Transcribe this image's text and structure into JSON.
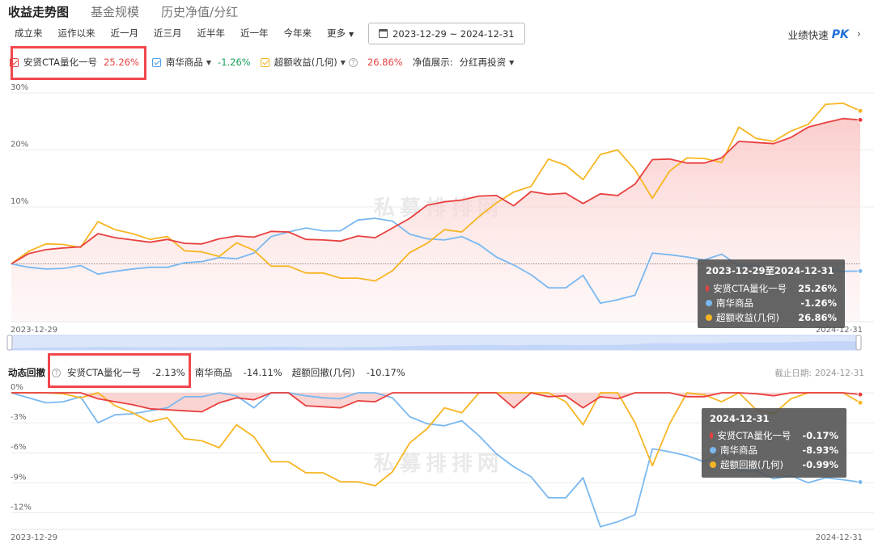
{
  "tabs": [
    "收益走势图",
    "基金规模",
    "历史净值/分红"
  ],
  "ranges": [
    "成立来",
    "运作以来",
    "近一月",
    "近三月",
    "近半年",
    "近一年",
    "今年来"
  ],
  "more_label": "更多",
  "date_range": "2023-12-29 ~ 2024-12-31",
  "pk": {
    "label": "业绩快速",
    "logo": "PK"
  },
  "legend": {
    "fund": {
      "name": "安贤CTA量化一号",
      "value": "25.26%"
    },
    "bench": {
      "name": "南华商品",
      "value": "-1.26%"
    },
    "excess": {
      "name": "超额收益(几何)",
      "value": "26.86%"
    },
    "nav_label": "净值展示:",
    "nav_mode": "分红再投资"
  },
  "watermark": "私募排排网",
  "drawdown_header": {
    "title": "动态回撤",
    "fund": {
      "name": "安贤CTA量化一号",
      "value": "-2.13%"
    },
    "bench": {
      "name": "南华商品",
      "value": "-14.11%"
    },
    "excess": {
      "name": "超额回撤(几何)",
      "value": "-10.17%"
    },
    "deadline_label": "截止日期:",
    "deadline_value": "2024-12-31"
  },
  "tooltip_top": {
    "title": "2023-12-29至2024-12-31",
    "rows": [
      {
        "name": "安贤CTA量化一号",
        "value": "25.26%"
      },
      {
        "name": "南华商品",
        "value": "-1.26%"
      },
      {
        "name": "超额收益(几何)",
        "value": "26.86%"
      }
    ]
  },
  "tooltip_bottom": {
    "title": "2024-12-31",
    "rows": [
      {
        "name": "安贤CTA量化一号",
        "value": "-0.17%"
      },
      {
        "name": "南华商品",
        "value": "-8.93%"
      },
      {
        "name": "超额回撤(几何)",
        "value": "-0.99%"
      }
    ]
  },
  "colors": {
    "fund": "#e8403f",
    "bench": "#7ab8f0",
    "excess": "#f7b522"
  },
  "chart_data": [
    {
      "type": "line",
      "ylim": [
        -10,
        30
      ],
      "ytick_values": [
        30,
        20,
        10
      ],
      "ytick_labels": [
        "30%",
        "20%",
        "10%"
      ],
      "x_labels": [
        "2023-12-29",
        "2024-12-31"
      ],
      "series": [
        {
          "name": "安贤CTA量化一号",
          "values": [
            0,
            1.8,
            2.5,
            2.8,
            3.0,
            5.3,
            4.6,
            4.2,
            3.8,
            4.3,
            3.6,
            3.5,
            4.4,
            4.9,
            4.7,
            5.7,
            5.6,
            4.3,
            4.2,
            4.0,
            4.9,
            4.6,
            6.3,
            8.0,
            10.3,
            10.9,
            11.2,
            11.9,
            12.0,
            10.2,
            12.7,
            12.2,
            12.4,
            10.6,
            12.3,
            12.0,
            14.0,
            18.3,
            18.4,
            17.7,
            17.7,
            18.6,
            21.5,
            21.3,
            21.1,
            22.2,
            24.0,
            24.8,
            25.5,
            25.26
          ]
        },
        {
          "name": "南华商品",
          "values": [
            0,
            -0.6,
            -0.9,
            -0.8,
            -0.3,
            -1.8,
            -1.3,
            -0.9,
            -0.6,
            -0.6,
            0.2,
            0.4,
            1.1,
            0.9,
            1.9,
            4.8,
            5.6,
            6.3,
            5.8,
            5.8,
            7.7,
            8.0,
            7.5,
            5.2,
            4.4,
            4.2,
            4.8,
            3.4,
            1.2,
            -0.2,
            -1.9,
            -4.2,
            -4.2,
            -2.0,
            -6.9,
            -6.3,
            -5.5,
            1.9,
            1.6,
            1.2,
            0.7,
            1.7,
            -0.3,
            -0.3,
            -1.2,
            -0.9,
            -1.7,
            -1.1,
            -1.3,
            -1.26
          ]
        },
        {
          "name": "超额收益(几何)",
          "values": [
            0,
            2.2,
            3.5,
            3.4,
            2.9,
            7.4,
            6.0,
            5.3,
            4.3,
            4.8,
            2.3,
            2.1,
            1.3,
            3.7,
            2.4,
            -0.4,
            -0.4,
            -1.6,
            -1.6,
            -2.5,
            -2.5,
            -3.0,
            -1.2,
            2.0,
            3.6,
            6.0,
            5.6,
            8.3,
            10.7,
            12.6,
            13.6,
            18.4,
            17.3,
            14.8,
            19.2,
            20.0,
            16.5,
            11.5,
            16.3,
            18.6,
            18.5,
            17.8,
            24.0,
            22.0,
            21.5,
            23.3,
            24.5,
            28.0,
            28.2,
            26.86
          ]
        }
      ]
    },
    {
      "type": "line",
      "ylim": [
        -13.5,
        0
      ],
      "ytick_values": [
        0,
        -3,
        -6,
        -9,
        -12
      ],
      "ytick_labels": [
        "0%",
        "-3%",
        "-6%",
        "-9%",
        "-12%"
      ],
      "x_labels": [
        "2023-12-29",
        "2024-12-31"
      ],
      "series": [
        {
          "name": "安贤CTA量化一号",
          "values": [
            0,
            0,
            0,
            0,
            0,
            -0.6,
            -0.9,
            -1.2,
            -1.6,
            -1.7,
            -1.8,
            -1.9,
            -1.0,
            -0.5,
            -0.7,
            0,
            0,
            -1.3,
            -1.4,
            -1.5,
            -0.8,
            -0.9,
            0,
            0,
            0,
            0,
            0,
            0,
            0,
            -1.5,
            0,
            -0.4,
            -0.3,
            -1.5,
            -0.4,
            -0.6,
            0,
            0,
            0,
            -0.4,
            -0.4,
            0,
            0,
            -0.1,
            -0.3,
            0,
            0,
            0,
            0,
            -0.17
          ]
        },
        {
          "name": "南华商品",
          "values": [
            0,
            -0.5,
            -1.0,
            -0.9,
            -0.4,
            -3.0,
            -2.2,
            -2.1,
            -1.8,
            -1.5,
            -0.4,
            -0.4,
            0,
            -0.3,
            -1.5,
            0,
            0,
            -0.3,
            -0.5,
            -0.6,
            0,
            0,
            -0.5,
            -2.4,
            -3.1,
            -3.3,
            -2.8,
            -4.3,
            -6.1,
            -7.4,
            -8.4,
            -10.5,
            -10.5,
            -8.5,
            -13.4,
            -12.9,
            -12.2,
            -5.6,
            -5.9,
            -6.3,
            -6.9,
            -5.9,
            -7.8,
            -7.8,
            -8.6,
            -8.3,
            -9.0,
            -8.5,
            -8.7,
            -8.93
          ]
        },
        {
          "name": "超额回撤(几何)",
          "values": [
            0,
            0,
            0,
            -0.1,
            -0.5,
            0,
            -1.3,
            -2.0,
            -2.9,
            -2.5,
            -4.6,
            -4.8,
            -5.5,
            -3.2,
            -4.4,
            -6.9,
            -6.9,
            -8.0,
            -8.0,
            -8.9,
            -8.9,
            -9.3,
            -7.9,
            -5.0,
            -3.6,
            -1.5,
            -2.0,
            0,
            0,
            0,
            0,
            0,
            -0.9,
            -3.2,
            0,
            0,
            -3.0,
            -7.3,
            -3.1,
            0,
            -0.2,
            -0.9,
            0,
            -1.7,
            -2.1,
            -0.6,
            0,
            0,
            0,
            -0.99
          ]
        }
      ]
    }
  ]
}
